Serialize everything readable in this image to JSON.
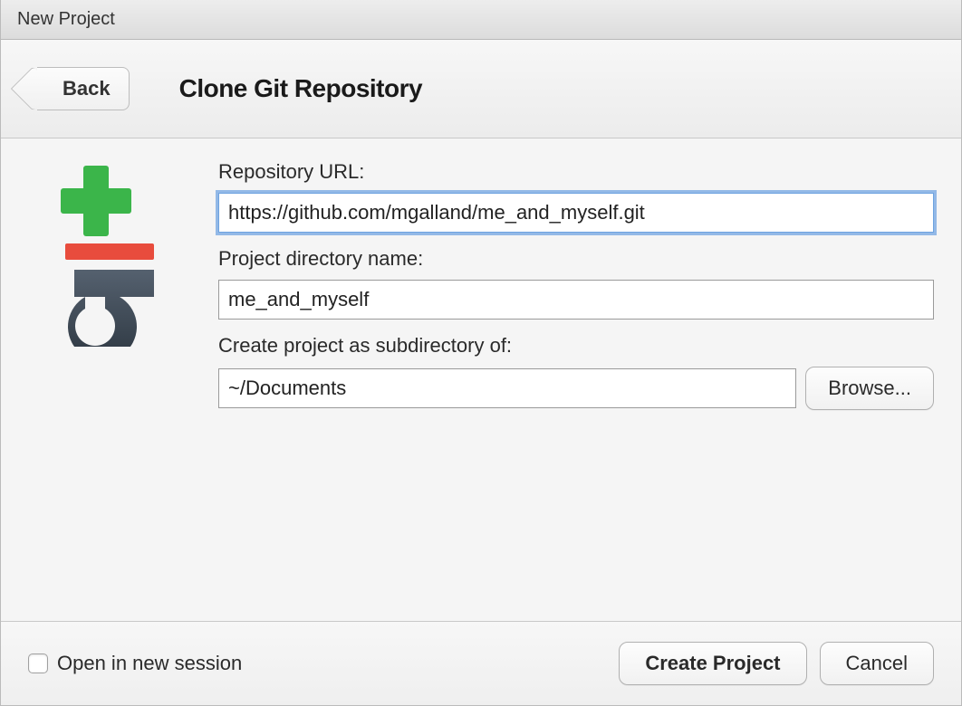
{
  "window": {
    "title": "New Project"
  },
  "header": {
    "back_label": "Back",
    "heading": "Clone Git Repository"
  },
  "form": {
    "repo_url_label": "Repository URL:",
    "repo_url_value": "https://github.com/mgalland/me_and_myself.git",
    "project_dir_label": "Project directory name:",
    "project_dir_value": "me_and_myself",
    "subdir_label": "Create project as subdirectory of:",
    "subdir_value": "~/Documents",
    "browse_label": "Browse..."
  },
  "footer": {
    "open_new_session_label": "Open in new session",
    "create_label": "Create Project",
    "cancel_label": "Cancel"
  }
}
